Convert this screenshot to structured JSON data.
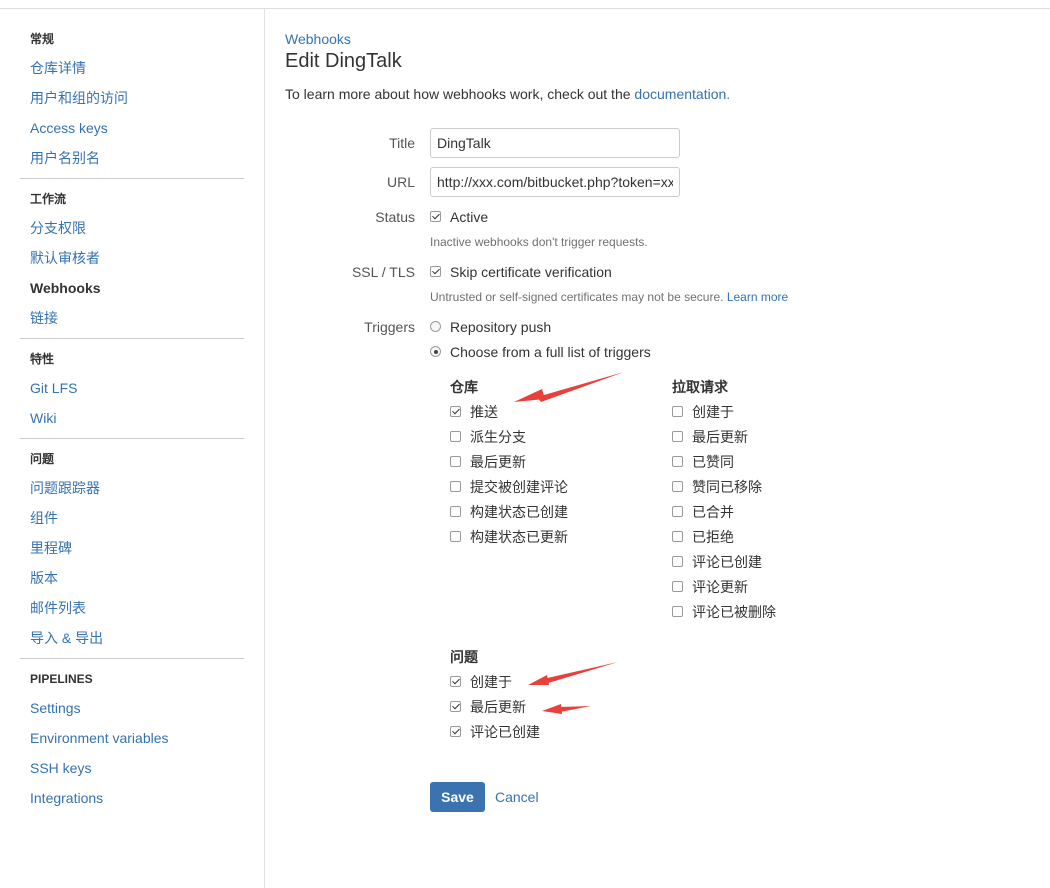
{
  "sidebar": {
    "groups": [
      {
        "heading": "常规",
        "items": [
          "仓库详情",
          "用户和组的访问",
          "Access keys",
          "用户名别名"
        ]
      },
      {
        "heading": "工作流",
        "items": [
          "分支权限",
          "默认审核者",
          "Webhooks",
          "链接"
        ]
      },
      {
        "heading": "特性",
        "items": [
          "Git LFS",
          "Wiki"
        ]
      },
      {
        "heading": "问题",
        "items": [
          "问题跟踪器",
          "组件",
          "里程碑",
          "版本",
          "邮件列表",
          "导入 & 导出"
        ]
      },
      {
        "heading": "PIPELINES",
        "items": [
          "Settings",
          "Environment variables",
          "SSH keys",
          "Integrations"
        ]
      }
    ]
  },
  "page": {
    "breadcrumb": "Webhooks",
    "title": "Edit DingTalk",
    "intro_text": "To learn more about how webhooks work, check out the ",
    "intro_link": "documentation."
  },
  "form": {
    "title_label": "Title",
    "title_value": "DingTalk",
    "url_label": "URL",
    "url_value": "http://xxx.com/bitbucket.php?token=xxx",
    "status_label": "Status",
    "status_option": "Active",
    "status_help": "Inactive webhooks don't trigger requests.",
    "ssl_label": "SSL / TLS",
    "ssl_option": "Skip certificate verification",
    "ssl_help": "Untrusted or self-signed certificates may not be secure. ",
    "ssl_help_link": "Learn more",
    "triggers_label": "Triggers",
    "trigger_push": "Repository push",
    "trigger_full": "Choose from a full list of triggers"
  },
  "trigger_groups": {
    "repo": {
      "heading": "仓库",
      "items": [
        "推送",
        "派生分支",
        "最后更新",
        "提交被创建评论",
        "构建状态已创建",
        "构建状态已更新"
      ]
    },
    "pr": {
      "heading": "拉取请求",
      "items": [
        "创建于",
        "最后更新",
        "已赞同",
        "赞同已移除",
        "已合并",
        "已拒绝",
        "评论已创建",
        "评论更新",
        "评论已被删除"
      ]
    },
    "issue": {
      "heading": "问题",
      "items": [
        "创建于",
        "最后更新",
        "评论已创建"
      ]
    }
  },
  "buttons": {
    "save": "Save",
    "cancel": "Cancel"
  },
  "colors": {
    "link": "#3572b0",
    "primary_button": "#3b73af",
    "annotation_arrow": "#e8403a"
  }
}
